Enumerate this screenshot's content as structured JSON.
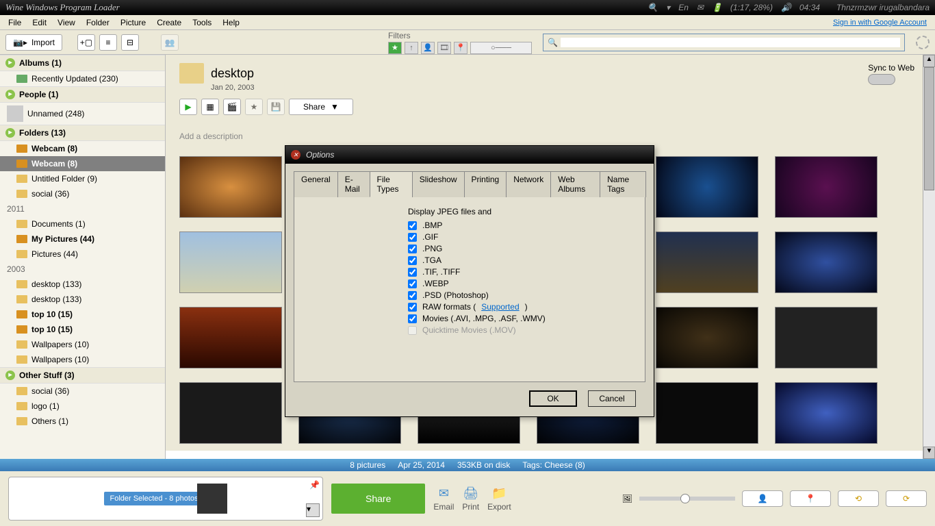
{
  "topbar": {
    "title": "Wine Windows Program Loader",
    "lang": "En",
    "battery": "(1:17, 28%)",
    "time": "04:34",
    "user": "Thnzrmzwr irugalbandara"
  },
  "menubar": [
    "File",
    "Edit",
    "View",
    "Folder",
    "Picture",
    "Create",
    "Tools",
    "Help"
  ],
  "signin": "Sign in with Google Account",
  "toolbar": {
    "import": "Import",
    "filters": "Filters"
  },
  "sidebar": {
    "albums": {
      "header": "Albums (1)",
      "items": [
        {
          "label": "Recently Updated (230)"
        }
      ]
    },
    "people": {
      "header": "People (1)",
      "items": [
        {
          "label": "Unnamed (248)"
        }
      ]
    },
    "folders": {
      "header": "Folders (13)",
      "groups": [
        {
          "items": [
            {
              "label": "Webcam (8)",
              "bold": true
            },
            {
              "label": "Webcam (8)",
              "bold": true,
              "selected": true
            },
            {
              "label": "Untitled Folder (9)"
            },
            {
              "label": "social (36)"
            }
          ]
        },
        {
          "year": "2011",
          "items": [
            {
              "label": "Documents (1)"
            },
            {
              "label": "My Pictures (44)",
              "bold": true
            },
            {
              "label": "Pictures (44)"
            }
          ]
        },
        {
          "year": "2003",
          "items": [
            {
              "label": "desktop (133)"
            },
            {
              "label": "desktop (133)"
            },
            {
              "label": "top 10 (15)",
              "bold": true
            },
            {
              "label": "top 10 (15)",
              "bold": true
            },
            {
              "label": "Wallpapers (10)"
            },
            {
              "label": "Wallpapers (10)"
            }
          ]
        }
      ]
    },
    "other": {
      "header": "Other Stuff (3)",
      "items": [
        {
          "label": "social (36)"
        },
        {
          "label": "logo (1)"
        },
        {
          "label": "Others (1)"
        }
      ]
    }
  },
  "content": {
    "folder": "desktop",
    "date": "Jan 20, 2003",
    "share": "Share",
    "desc": "Add a description",
    "sync": "Sync to Web"
  },
  "status": {
    "pics": "8 pictures",
    "date": "Apr 25, 2014",
    "size": "353KB on disk",
    "tags": "Tags: Cheese (8)"
  },
  "bottom": {
    "tray": "Folder Selected - 8 photos",
    "share": "Share",
    "email": "Email",
    "print": "Print",
    "export": "Export"
  },
  "dialog": {
    "title": "Options",
    "tabs": [
      "General",
      "E-Mail",
      "File Types",
      "Slideshow",
      "Printing",
      "Network",
      "Web Albums",
      "Name Tags"
    ],
    "active_tab": 2,
    "heading": "Display JPEG files and",
    "types": [
      {
        "label": ".BMP",
        "checked": true
      },
      {
        "label": ".GIF",
        "checked": true
      },
      {
        "label": ".PNG",
        "checked": true
      },
      {
        "label": ".TGA",
        "checked": true
      },
      {
        "label": ".TIF, .TIFF",
        "checked": true
      },
      {
        "label": ".WEBP",
        "checked": true
      },
      {
        "label": ".PSD (Photoshop)",
        "checked": true
      },
      {
        "label": "RAW formats  (",
        "checked": true,
        "link": "Supported",
        "suffix": ")"
      },
      {
        "label": "Movies (.AVI, .MPG, .ASF, .WMV)",
        "checked": true
      },
      {
        "label": "Quicktime Movies (.MOV)",
        "checked": false,
        "disabled": true
      }
    ],
    "ok": "OK",
    "cancel": "Cancel"
  }
}
